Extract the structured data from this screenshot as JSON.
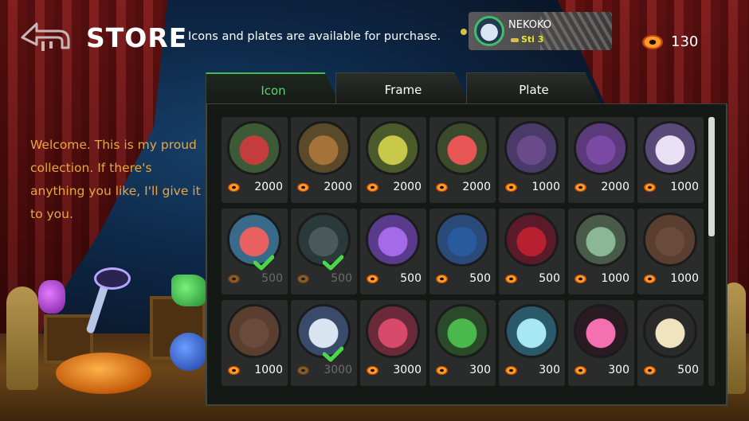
{
  "header": {
    "title": "STORE",
    "description": "Icons and plates are available for purchase."
  },
  "player": {
    "name": "NEKOKO",
    "level": "Sti 3"
  },
  "currency": {
    "amount": "130"
  },
  "welcome_text": "Welcome. This is my proud collection. If there's anything you like, I'll give it to you.",
  "tabs": [
    {
      "label": "Icon",
      "active": true
    },
    {
      "label": "Frame",
      "active": false
    },
    {
      "label": "Plate",
      "active": false
    }
  ],
  "items": [
    {
      "price": "2000",
      "owned": false,
      "color": "#c43d3d",
      "bg": "#3d5a36"
    },
    {
      "price": "2000",
      "owned": false,
      "color": "#a5733a",
      "bg": "#5a4a2a"
    },
    {
      "price": "2000",
      "owned": false,
      "color": "#c8c84a",
      "bg": "#4a5a2a"
    },
    {
      "price": "2000",
      "owned": false,
      "color": "#e85555",
      "bg": "#3a4a2a"
    },
    {
      "price": "1000",
      "owned": false,
      "color": "#6a4a8a",
      "bg": "#4a3a6a"
    },
    {
      "price": "2000",
      "owned": false,
      "color": "#7a4aa5",
      "bg": "#5a3a7a"
    },
    {
      "price": "1000",
      "owned": false,
      "color": "#e8e0f5",
      "bg": "#5a4a7a"
    },
    {
      "price": "500",
      "owned": true,
      "color": "#e86060",
      "bg": "#3a6a8a"
    },
    {
      "price": "500",
      "owned": true,
      "color": "#4a5a5a",
      "bg": "#2a3a3a"
    },
    {
      "price": "500",
      "owned": false,
      "color": "#a56ae8",
      "bg": "#5a3a8a"
    },
    {
      "price": "500",
      "owned": false,
      "color": "#2a5a9e",
      "bg": "#2a4a7a"
    },
    {
      "price": "500",
      "owned": false,
      "color": "#b82030",
      "bg": "#5a1a2a"
    },
    {
      "price": "1000",
      "owned": false,
      "color": "#8ab894",
      "bg": "#4a5a4a"
    },
    {
      "price": "1000",
      "owned": false,
      "color": "#6a4a3a",
      "bg": "#5a3f30"
    },
    {
      "price": "1000",
      "owned": false,
      "color": "#6a4a3a",
      "bg": "#5a3f30"
    },
    {
      "price": "3000",
      "owned": true,
      "color": "#d8e4f0",
      "bg": "#3a4a6a"
    },
    {
      "price": "3000",
      "owned": false,
      "color": "#d84a6a",
      "bg": "#6a2a3a"
    },
    {
      "price": "300",
      "owned": false,
      "color": "#4ab84a",
      "bg": "#2a4a2a"
    },
    {
      "price": "300",
      "owned": false,
      "color": "#a8e8f5",
      "bg": "#2a5a6a"
    },
    {
      "price": "300",
      "owned": false,
      "color": "#f570b0",
      "bg": "#2a1a22"
    },
    {
      "price": "500",
      "owned": false,
      "color": "#f0e4c0",
      "bg": "#2a2a2a"
    }
  ],
  "scroll": {
    "position_fraction": 0.0
  },
  "colors": {
    "accent": "#58d86c",
    "price_text": "#ffffff",
    "owned_price_text": "#6b6b6b",
    "welcome_text": "#e9a63c"
  },
  "icons": {
    "back": "back-arrow-icon",
    "currency": "amber-coin-icon",
    "owned_check": "checkmark-icon"
  }
}
